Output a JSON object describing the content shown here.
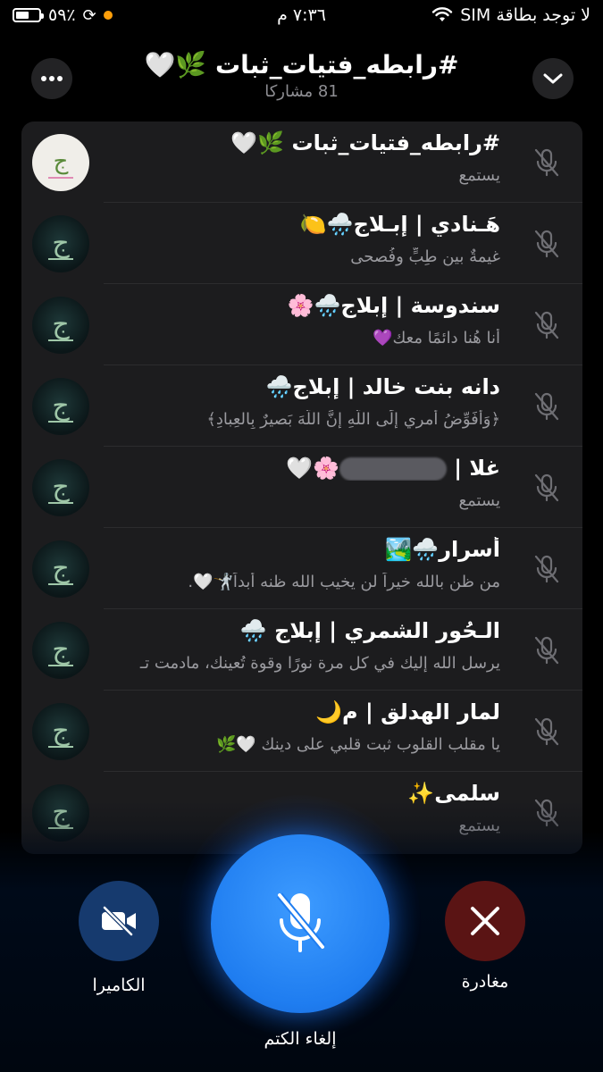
{
  "status_bar": {
    "battery_text": "٥٩٪",
    "battery_level": 0.59,
    "time": "٧:٣٦ م",
    "carrier": "لا توجد بطاقة SIM"
  },
  "header": {
    "title": "#رابطه_فتيات_ثبات 🌿🤍",
    "subtitle": "81 مشاركا"
  },
  "participants": [
    {
      "name": "#رابطه_فتيات_ثبات 🌿🤍",
      "status": "يستمع",
      "avatar_style": "light"
    },
    {
      "name": "هَـنادي | إبـلاج🌧️🍋",
      "status": "غيمةٌ بين طِبٍّ وفُصحى",
      "avatar_style": "dark"
    },
    {
      "name": "سندوسة | إبلاج🌧️🌸",
      "status": "أنا هُنا دائمًا معك💜",
      "avatar_style": "dark"
    },
    {
      "name": "دانه بنت خالد | إبلاج🌧️",
      "status": "﴿وَأُفَوِّضُ أَمري إِلَى اللَّهِ إِنَّ اللَّهَ بَصيرٌ بِالعِبادِ﴾",
      "avatar_style": "dark"
    },
    {
      "name": "غلا | ",
      "name_suffix": "🌸🤍",
      "status": "يستمع",
      "avatar_style": "dark",
      "redacted": true
    },
    {
      "name": "أسرار🌧️🏞️",
      "status": "من ظن بالله خيراً لن يخيب الله ظنه أبداً🤺🤍.",
      "avatar_style": "dark"
    },
    {
      "name": "الـحُور الشمري | إبلاج 🌧️",
      "status": "يرسل الله إليك في كل مرة نورًا وقوة تُعينك، مادمت تـ",
      "avatar_style": "dark"
    },
    {
      "name": "لمار الهدلق | م🌙",
      "status": "يا مقلب القلوب ثبت قلبي على دينك 🤍🌿",
      "avatar_style": "dark"
    },
    {
      "name": "سلمى✨",
      "status": "يستمع",
      "avatar_style": "dark"
    }
  ],
  "controls": {
    "camera_label": "الكاميرا",
    "unmute_label": "إلغاء الكتم",
    "leave_label": "مغادرة"
  },
  "icons": {
    "more": "more-icon",
    "chevron": "chevron-down-icon",
    "mic_off": "mic-off-icon",
    "camera_off": "camera-off-icon",
    "close": "close-icon"
  },
  "colors": {
    "accent": "#1f7df0",
    "leave": "#5a1414",
    "camera": "#163a6e",
    "list_bg": "#1c1c1e"
  }
}
